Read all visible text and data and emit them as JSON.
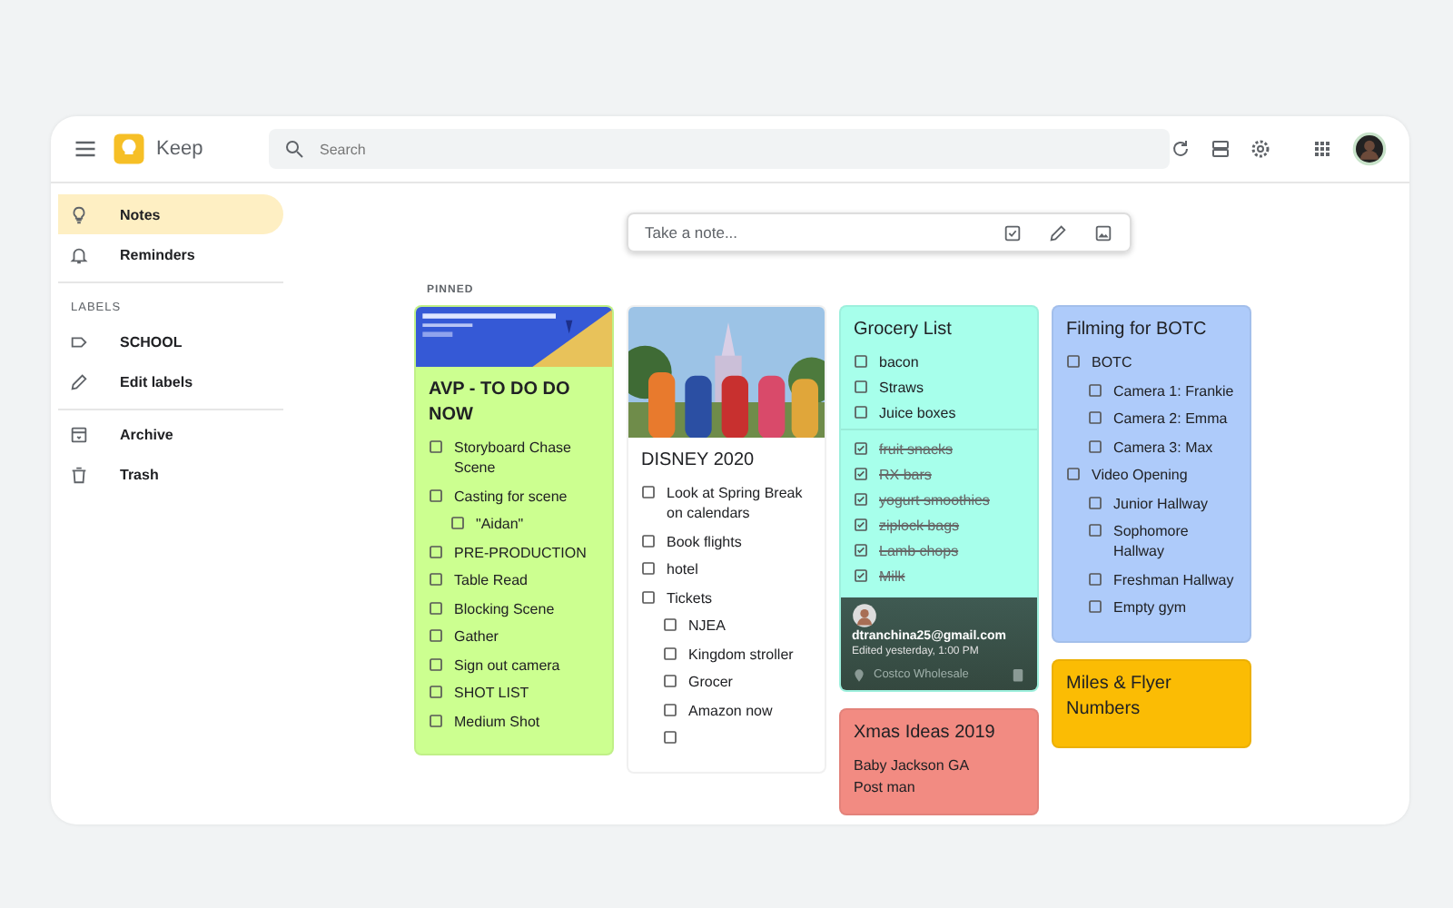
{
  "header": {
    "app_name": "Keep",
    "search_placeholder": "Search"
  },
  "sidebar": {
    "sections": [
      {
        "items": [
          {
            "label": "Notes",
            "selected": true
          },
          {
            "label": "Reminders",
            "selected": false
          }
        ]
      },
      {
        "heading": "LABELS",
        "items": [
          {
            "label": "SCHOOL",
            "selected": false
          },
          {
            "label": "Edit labels",
            "selected": false
          }
        ]
      },
      {
        "items": [
          {
            "label": "Archive",
            "selected": false
          },
          {
            "label": "Trash",
            "selected": false
          }
        ]
      }
    ]
  },
  "take_note": {
    "placeholder": "Take a note..."
  },
  "pinned_heading": "PINNED",
  "columns": [
    [
      {
        "title": "AVP - TO DO DO NOW",
        "color": "#ccff90",
        "image": {
          "kind": "picture"
        },
        "items": [
          {
            "text": "Storyboard Chase Scene",
            "checked": false
          },
          {
            "text": "Casting for scene",
            "checked": false,
            "children": [
              {
                "text": "\"Aidan\"",
                "checked": false
              }
            ]
          },
          {
            "text": "PRE-PRODUCTION",
            "checked": false
          },
          {
            "text": "Table Read",
            "checked": false
          },
          {
            "text": "Blocking Scene",
            "checked": false
          },
          {
            "text": "Gather",
            "checked": false
          },
          {
            "text": "Sign out camera",
            "checked": false
          },
          {
            "text": "SHOT LIST",
            "checked": false
          },
          {
            "text": "Medium Shot",
            "checked": false
          }
        ]
      }
    ],
    [
      {
        "title": "DISNEY 2020",
        "color": "#ffffff",
        "image": {
          "kind": "picture"
        },
        "items": [
          {
            "text": "Look at Spring Break on calendars",
            "checked": false
          },
          {
            "text": "Book flights",
            "checked": false
          },
          {
            "text": "hotel",
            "checked": false
          },
          {
            "text": "Tickets",
            "checked": false,
            "children": [
              {
                "text": "NJEA",
                "checked": false
              },
              {
                "text": "Kingdom stroller",
                "checked": false
              },
              {
                "text": "Grocer",
                "checked": false
              },
              {
                "text": "Amazon now",
                "checked": false
              },
              {
                "checked": false
              }
            ]
          }
        ]
      }
    ],
    [
      {
        "title": "Grocery List",
        "color": "#a7ffeb",
        "items": [
          {
            "text": "bacon",
            "checked": false
          },
          {
            "text": "Straws",
            "checked": false
          },
          {
            "text": "Juice boxes",
            "checked": false
          },
          {
            "text": "fruit snacks",
            "checked": true
          },
          {
            "text": "RX bars",
            "checked": true
          },
          {
            "text": "yogurt smoothies",
            "checked": true
          },
          {
            "text": "ziplock bags",
            "checked": true
          },
          {
            "text": "Lamb chops",
            "checked": true
          },
          {
            "text": "Milk",
            "checked": true
          }
        ],
        "popup": {
          "email": "dtranchina25@gmail.com",
          "edited": "Edited yesterday, 1:00 PM",
          "location": "Costco Wholesale"
        }
      },
      {
        "title": "Xmas Ideas 2019",
        "color": "#f28b82",
        "lines": [
          "Baby Jackson GA",
          "Post man"
        ]
      }
    ],
    [
      {
        "title": "Filming for BOTC",
        "color": "#aecbfa",
        "items": [
          {
            "text": "BOTC",
            "checked": false,
            "children": [
              {
                "text": "Camera 1:  Frankie",
                "checked": false
              },
              {
                "text": "Camera 2:  Emma",
                "checked": false
              },
              {
                "text": "Camera 3:  Max",
                "checked": false
              }
            ]
          },
          {
            "text": "Video Opening",
            "checked": false,
            "children": [
              {
                "text": "Junior Hallway",
                "checked": false
              },
              {
                "text": "Sophomore Hallway",
                "checked": false
              },
              {
                "text": "Freshman Hallway",
                "checked": false
              },
              {
                "text": "Empty gym",
                "checked": false
              }
            ]
          }
        ]
      },
      {
        "title": "Miles & Flyer Numbers",
        "color": "#fbbc04"
      }
    ]
  ]
}
